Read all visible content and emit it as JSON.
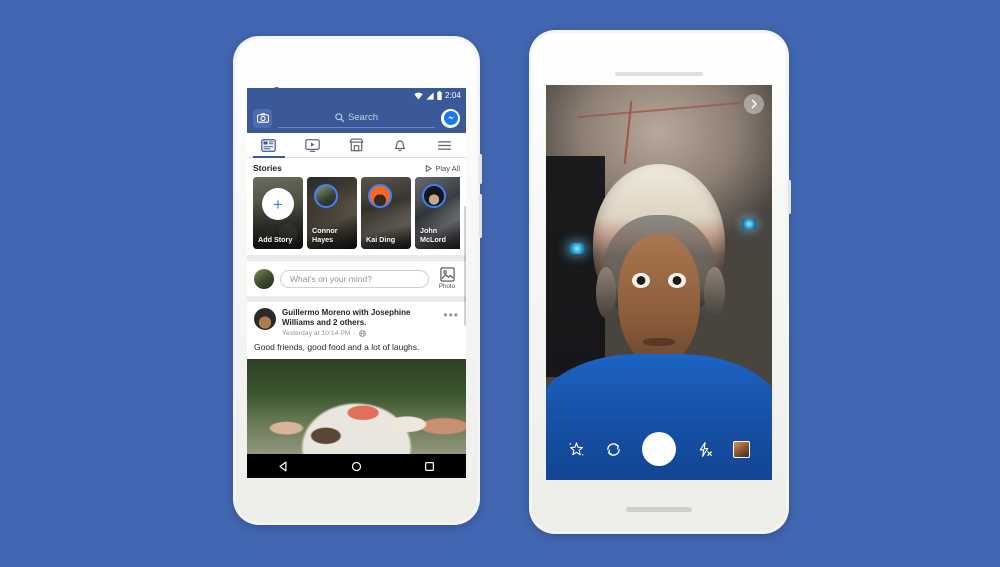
{
  "background_color": "#4267B2",
  "left_phone": {
    "device_name": "white-android-phone",
    "statusbar": {
      "time": "2:04",
      "icons": [
        "wifi-icon",
        "signal-icon",
        "battery-icon"
      ]
    },
    "app": {
      "name": "Facebook",
      "topbar": {
        "camera_icon": "camera-icon",
        "search_placeholder": "Search",
        "search_icon": "search-icon",
        "messenger_icon": "messenger-icon"
      },
      "tabs": [
        {
          "name": "news-feed",
          "icon": "news-feed-icon",
          "active": true
        },
        {
          "name": "watch",
          "icon": "video-play-icon",
          "active": false
        },
        {
          "name": "marketplace",
          "icon": "store-icon",
          "active": false
        },
        {
          "name": "notifications",
          "icon": "bell-icon",
          "active": false
        },
        {
          "name": "menu",
          "icon": "hamburger-menu-icon",
          "active": false
        }
      ],
      "stories": {
        "title": "Stories",
        "play_all_label": "Play All",
        "play_all_icon": "play-triangle-icon",
        "cards": [
          {
            "label": "Add Story",
            "type": "add",
            "icon": "plus-icon"
          },
          {
            "label": "Connor Hayes",
            "type": "story"
          },
          {
            "label": "Kai Ding",
            "type": "story"
          },
          {
            "label": "John McLord",
            "type": "story"
          }
        ]
      },
      "composer": {
        "placeholder": "What's on your mind?",
        "photo_label": "Photo",
        "photo_icon": "photo-icon",
        "avatar": "user-avatar"
      },
      "post": {
        "author_line": "Guillermo Moreno with Josephine Williams and 2 others.",
        "timestamp": "Yesterday at 10:14 PM",
        "privacy_icon": "globe-icon",
        "separator": "·",
        "body": "Good friends, good food and a lot of laughs.",
        "menu_icon": "more-options-icon",
        "photo_alt": "family-gathering-photo"
      },
      "android_nav": [
        {
          "name": "back-button",
          "icon": "back-triangle-icon"
        },
        {
          "name": "home-button",
          "icon": "home-circle-icon"
        },
        {
          "name": "recents-button",
          "icon": "recents-square-icon"
        }
      ]
    }
  },
  "right_phone": {
    "device_name": "white-android-phone",
    "app": {
      "name": "Facebook Camera",
      "next_icon": "chevron-right-icon",
      "subject_alt": "selfie-with-astronaut-helmet-ar-effect",
      "controls": [
        {
          "name": "effects-button",
          "icon": "magic-star-icon"
        },
        {
          "name": "flip-camera-button",
          "icon": "camera-flip-icon"
        },
        {
          "name": "shutter-button",
          "icon": "shutter-circle-icon"
        },
        {
          "name": "flash-button",
          "icon": "flash-off-icon"
        },
        {
          "name": "gallery-button",
          "icon": "gallery-thumbnail-icon"
        }
      ]
    }
  }
}
